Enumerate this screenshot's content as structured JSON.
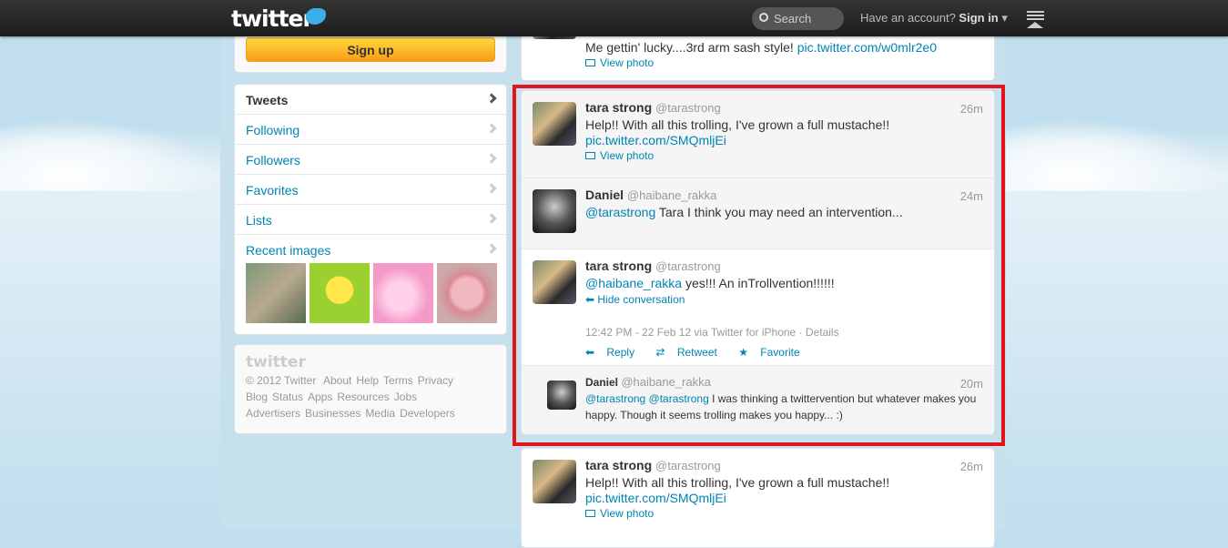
{
  "topbar": {
    "logo": "twitter",
    "search_placeholder": "Search",
    "account_prompt": "Have an account?",
    "signin": "Sign in"
  },
  "signup": {
    "label": "Sign up"
  },
  "nav": {
    "items": [
      {
        "label": "Tweets"
      },
      {
        "label": "Following"
      },
      {
        "label": "Followers"
      },
      {
        "label": "Favorites"
      },
      {
        "label": "Lists"
      },
      {
        "label": "Recent images"
      }
    ]
  },
  "footer": {
    "logo": "twitter",
    "copyright": "© 2012 Twitter",
    "links": [
      "About",
      "Help",
      "Terms",
      "Privacy",
      "Blog",
      "Status",
      "Apps",
      "Resources",
      "Jobs",
      "Advertisers",
      "Businesses",
      "Media",
      "Developers"
    ]
  },
  "tweets": {
    "top": {
      "text": "Me gettin' lucky....3rd arm sash style! ",
      "link": "pic.twitter.com/w0mlr2e0",
      "view": "View photo"
    },
    "t1": {
      "name": "tara strong",
      "handle": "@tarastrong",
      "time": "26m",
      "text": "Help!! With all this trolling, I've grown a full mustache!!",
      "link": "pic.twitter.com/SMQmljEi",
      "view": "View photo"
    },
    "t2": {
      "name": "Daniel",
      "handle": "@haibane_rakka",
      "time": "24m",
      "mention": "@tarastrong",
      "text": " Tara I think you may need an intervention..."
    },
    "t3": {
      "name": "tara strong",
      "handle": "@tarastrong",
      "mention": "@haibane_rakka",
      "text": " yes!!! An inTrollvention!!!!!!",
      "hide": "Hide conversation",
      "meta": "12:42 PM - 22 Feb 12 via Twitter for iPhone · Details",
      "reply": "Reply",
      "retweet": "Retweet",
      "favorite": "Favorite"
    },
    "t4": {
      "name": "Daniel",
      "handle": "@haibane_rakka",
      "time": "20m",
      "mentions": "@tarastrong @tarastrong",
      "text": " I was thinking a twittervention but whatever makes you happy. Though it seems trolling makes you happy... :)"
    },
    "t5": {
      "name": "tara strong",
      "handle": "@tarastrong",
      "time": "26m",
      "text": "Help!! With all this trolling, I've grown a full mustache!!",
      "link": "pic.twitter.com/SMQmljEi",
      "view": "View photo"
    }
  }
}
